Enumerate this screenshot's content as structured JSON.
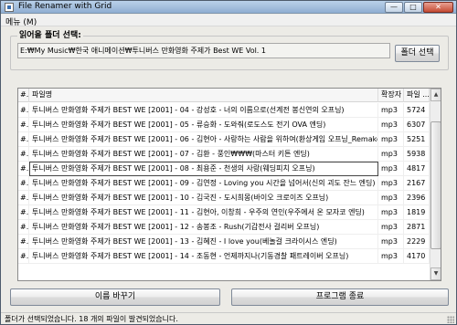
{
  "window": {
    "title": "File Renamer with Grid",
    "minimize": "—",
    "maximize": "□",
    "close": "✕"
  },
  "menu": {
    "label": "메뉴 (M)"
  },
  "folder": {
    "group_label": "읽어올 폴더 선택:",
    "path": "E:₩My Music₩한국 애니메이션₩투니버스 만화영화 주제가 Best WE Vol. 1",
    "select_button": "폴더 선택"
  },
  "table": {
    "columns": [
      "#.",
      "파일명",
      "확장자",
      "파일 ..."
    ],
    "rows": [
      {
        "marker": "#.",
        "name": "투니버스 만화영화 주제가 BEST WE [2001] - 04 - 강성호 - 너의 이름으로(선계전 봉신연의 오프닝)",
        "ext": "mp3",
        "size": "5724"
      },
      {
        "marker": "#.",
        "name": "투니버스 만화영화 주제가 BEST WE [2001] - 05 - 류승화 - 도와줘(로도스도 전기 OVA  엔딩)",
        "ext": "mp3",
        "size": "6307"
      },
      {
        "marker": "#.",
        "name": "투니버스 만화영화 주제가 BEST WE [2001] - 06 - 김현아 - 사랑하는 사람을 위하여(환상게임 오프닝_Remake)",
        "ext": "mp3",
        "size": "5251"
      },
      {
        "marker": "#.",
        "name": "투니버스 만화영화 주제가 BEST WE [2001] - 07 - 김환 - 풍인₩₩₩(마스터 키튼 엔딩)",
        "ext": "mp3",
        "size": "5938"
      },
      {
        "marker": "#.",
        "name": "투니버스 만화영화 주제가 BEST WE [2001] - 08 - 최용준 - 천생의 사랑(웨딩피치 오프닝)",
        "ext": "mp3",
        "size": "4817"
      },
      {
        "marker": "#.",
        "name": "투니버스 만화영화 주제가 BEST WE [2001] - 09 - 김연정 - Loving you 시간을 넘어서(신의 괴도 잔느 엔딩)",
        "ext": "mp3",
        "size": "2167"
      },
      {
        "marker": "#.",
        "name": "투니버스 만화영화 주제가 BEST WE [2001] - 10 - 김국진 - 도시희몽(바이오 크로이즈 오프닝)",
        "ext": "mp3",
        "size": "2396"
      },
      {
        "marker": "#.",
        "name": "투니버스 만화영화 주제가 BEST WE [2001] - 11 - 김현아, 이창희 - 우주의 연인(우주에서 온 모자코 엔딩)",
        "ext": "mp3",
        "size": "1819"
      },
      {
        "marker": "#.",
        "name": "투니버스 만화영화 주제가 BEST WE [2001] - 12 - 송봉조 - Rush(기갑전사 걸리버 오프닝)",
        "ext": "mp3",
        "size": "2871"
      },
      {
        "marker": "#.",
        "name": "투니버스 만화영화 주제가 BEST WE [2001] - 13 - 김혜진 - I love you(베놀걸 크라이시스 엔딩)",
        "ext": "mp3",
        "size": "2229"
      },
      {
        "marker": "#.",
        "name": "투니버스 만화영화 주제가 BEST WE [2001] - 14 - 조동현 - 언제까지나(기동경찰 패트레이버 오프닝)",
        "ext": "mp3",
        "size": "4170"
      }
    ],
    "selected_row": 4
  },
  "scrollbar": {
    "up": "▲",
    "down": "▼"
  },
  "buttons": {
    "rename": "이름 바꾸기",
    "exit": "프로그램 종료"
  },
  "status": {
    "text": "폴더가 선택되었습니다. 18 개의 파일이 발견되었습니다."
  }
}
